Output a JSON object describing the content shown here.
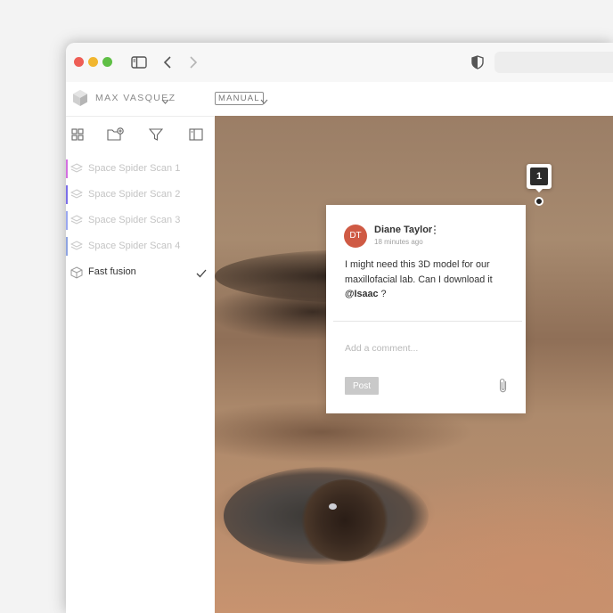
{
  "window": {
    "url": ""
  },
  "user": {
    "name": "MAX VASQUEZ"
  },
  "mode": {
    "label": "MANUAL"
  },
  "sidebar": {
    "tools": [
      "grid-icon",
      "add-folder-icon",
      "filter-icon",
      "panel-icon"
    ],
    "items": [
      {
        "label": "Space Spider Scan 1",
        "accent": "#d36fe0",
        "active": false
      },
      {
        "label": "Space Spider Scan 2",
        "accent": "#7b6ee8",
        "active": false
      },
      {
        "label": "Space Spider Scan 3",
        "accent": "#9aa7ef",
        "active": false
      },
      {
        "label": "Space Spider Scan 4",
        "accent": "#8ea3e0",
        "active": false
      },
      {
        "label": "Fast fusion",
        "accent": "",
        "active": true
      }
    ]
  },
  "annotation": {
    "pin_number": "1"
  },
  "comment": {
    "avatar_initials": "DT",
    "avatar_color": "#cf5a44",
    "author": "Diane Taylor",
    "time": "18 minutes ago",
    "body_text": "I might need this 3D model for our maxillofacial lab. Can I download it",
    "mention": "@Isaac",
    "body_tail": " ?",
    "input_placeholder": "Add a comment...",
    "post_label": "Post"
  }
}
